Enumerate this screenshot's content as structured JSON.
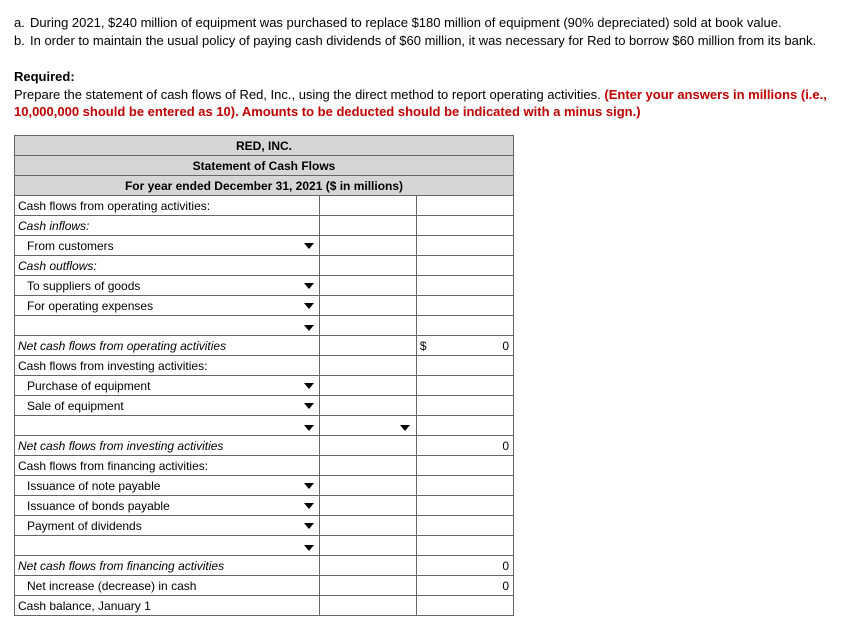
{
  "intro": {
    "a_letter": "a.",
    "a_text": "During 2021, $240 million of equipment was purchased to replace $180 million of equipment (90% depreciated) sold at book value.",
    "b_letter": "b.",
    "b_text": "In order to maintain the usual policy of paying cash dividends of $60 million, it was necessary for Red to borrow $60 million from its bank."
  },
  "required": {
    "label": "Required:",
    "line1": "Prepare the statement of cash flows of Red, Inc., using the direct method to report operating activities. ",
    "red": "(Enter your answers in millions (i.e., 10,000,000 should be entered as 10). Amounts to be deducted should be indicated with a minus sign.)"
  },
  "table": {
    "h1": "RED, INC.",
    "h2": "Statement of Cash Flows",
    "h3": "For year ended December 31, 2021 ($ in millions)",
    "rows": {
      "op_hdr": "Cash flows from operating activities:",
      "inflows": "Cash inflows:",
      "from_customers": "From customers",
      "outflows": "Cash outflows:",
      "to_suppliers": "To suppliers of goods",
      "for_opex": "For operating expenses",
      "net_op": "Net cash flows from operating activities",
      "inv_hdr": "Cash flows from investing activities:",
      "purchase_eq": "Purchase of equipment",
      "sale_eq": "Sale of equipment",
      "net_inv": "Net cash flows from investing activities",
      "fin_hdr": "Cash flows from financing activities:",
      "note_pay": "Issuance of note payable",
      "bonds_pay": "Issuance of bonds payable",
      "pay_div": "Payment of dividends",
      "net_fin": "Net cash flows from financing activities",
      "net_inc": "Net increase (decrease) in cash",
      "jan1": "Cash balance, January 1"
    },
    "vals": {
      "dollar": "$",
      "zero": "0"
    }
  }
}
